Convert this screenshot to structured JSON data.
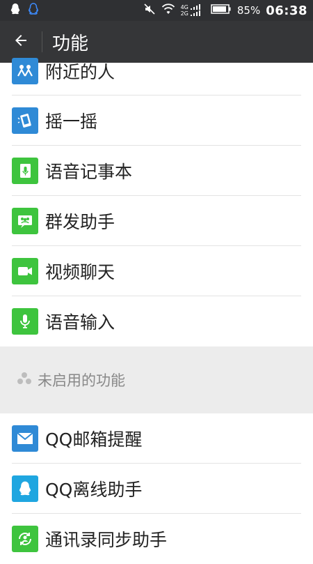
{
  "status_bar": {
    "battery": "85%",
    "time": "06:38",
    "network_top": "4G",
    "network_bottom": "2G"
  },
  "app_bar": {
    "title": "功能"
  },
  "colors": {
    "blue": "#2f8ad6",
    "green": "#3ec43e",
    "cyan": "#1fa6e0"
  },
  "enabled_features": [
    {
      "label": "附近的人",
      "icon": "nearby-people-icon"
    },
    {
      "label": "摇一摇",
      "icon": "shake-icon"
    },
    {
      "label": "语音记事本",
      "icon": "voice-notepad-icon"
    },
    {
      "label": "群发助手",
      "icon": "broadcast-helper-icon"
    },
    {
      "label": "视频聊天",
      "icon": "video-chat-icon"
    },
    {
      "label": "语音输入",
      "icon": "voice-input-icon"
    }
  ],
  "disabled_section": {
    "title": "未启用的功能"
  },
  "disabled_features": [
    {
      "label": "QQ邮箱提醒",
      "icon": "qq-mail-icon"
    },
    {
      "label": "QQ离线助手",
      "icon": "qq-offline-icon"
    },
    {
      "label": "通讯录同步助手",
      "icon": "contacts-sync-icon"
    }
  ]
}
